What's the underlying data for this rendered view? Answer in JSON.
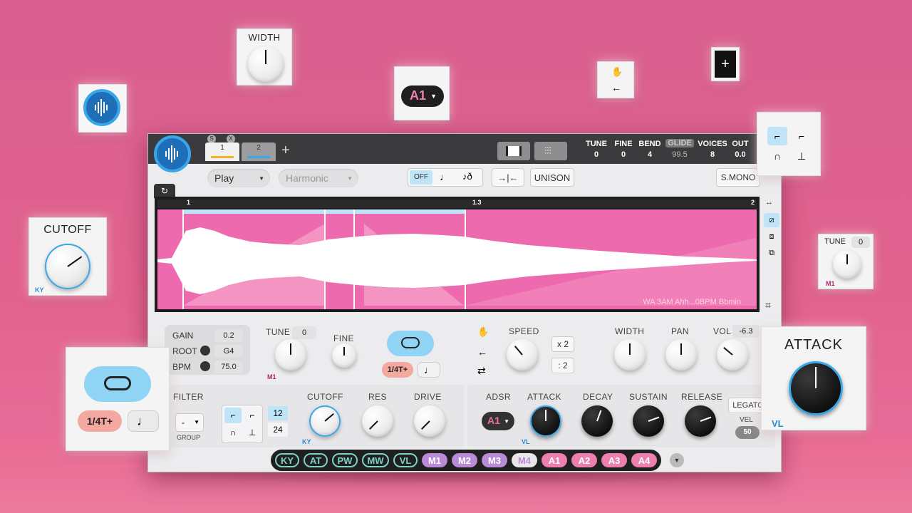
{
  "app": {
    "tabs": [
      "1",
      "2"
    ],
    "tab_badges": [
      "S",
      "X"
    ],
    "add_tab": "+"
  },
  "header": {
    "params": [
      {
        "label": "TUNE",
        "value": "0"
      },
      {
        "label": "FINE",
        "value": "0"
      },
      {
        "label": "BEND",
        "value": "4"
      },
      {
        "label": "GLIDE",
        "value": "99.5"
      },
      {
        "label": "VOICES",
        "value": "8"
      },
      {
        "label": "OUT",
        "value": "0.0"
      }
    ]
  },
  "toolbar": {
    "play_mode": "Play",
    "harmonic": "Harmonic",
    "off": "OFF",
    "unison": "UNISON",
    "smono": "S.MONO"
  },
  "waveform": {
    "markers": [
      "1",
      "1.3",
      "2"
    ],
    "sample_name": "WA 3AM Ahh...0BPM Bbmin"
  },
  "sample": {
    "gain_label": "GAIN",
    "gain": "0.2",
    "root_label": "ROOT",
    "root": "G4",
    "bpm_label": "BPM",
    "bpm": "75.0",
    "tune_label": "TUNE",
    "tune": "0",
    "tune_mod": "M1",
    "fine_label": "FINE",
    "loop_rate": "1/4T+",
    "speed_label": "SPEED",
    "x2": "x 2",
    "div2": ": 2",
    "width_label": "WIDTH",
    "pan_label": "PAN",
    "vol_label": "VOL",
    "vol": "-6.3"
  },
  "filter": {
    "label": "FILTER",
    "type": "-",
    "group": "GROUP",
    "slopes": [
      "12",
      "24"
    ],
    "cutoff_label": "CUTOFF",
    "cutoff_mod": "KY",
    "res_label": "RES",
    "drive_label": "DRIVE"
  },
  "adsr": {
    "label": "ADSR",
    "source": "A1",
    "attack": "ATTACK",
    "attack_mod": "VL",
    "decay": "DECAY",
    "sustain": "SUSTAIN",
    "release": "RELEASE",
    "legato": "LEGATO",
    "vel_label": "VEL",
    "vel": "50"
  },
  "mod_bar": [
    "KY",
    "AT",
    "PW",
    "MW",
    "VL",
    "M1",
    "M2",
    "M3",
    "M4",
    "A1",
    "A2",
    "A3",
    "A4"
  ],
  "floating": {
    "width": "WIDTH",
    "a1": "A1",
    "cutoff": "CUTOFF",
    "cutoff_mod": "KY",
    "tune": "TUNE",
    "tune_value": "0",
    "tune_mod": "M1",
    "attack": "ATTACK",
    "attack_mod": "VL",
    "loop_rate": "1/4T+",
    "plus": "+"
  },
  "colors": {
    "accent_blue": "#3aa7e6",
    "accent_pink": "#e9739f",
    "mod_teal": "#7ed3c8",
    "mod_purple": "#b98ad6",
    "mod_pink": "#ec7fae"
  }
}
